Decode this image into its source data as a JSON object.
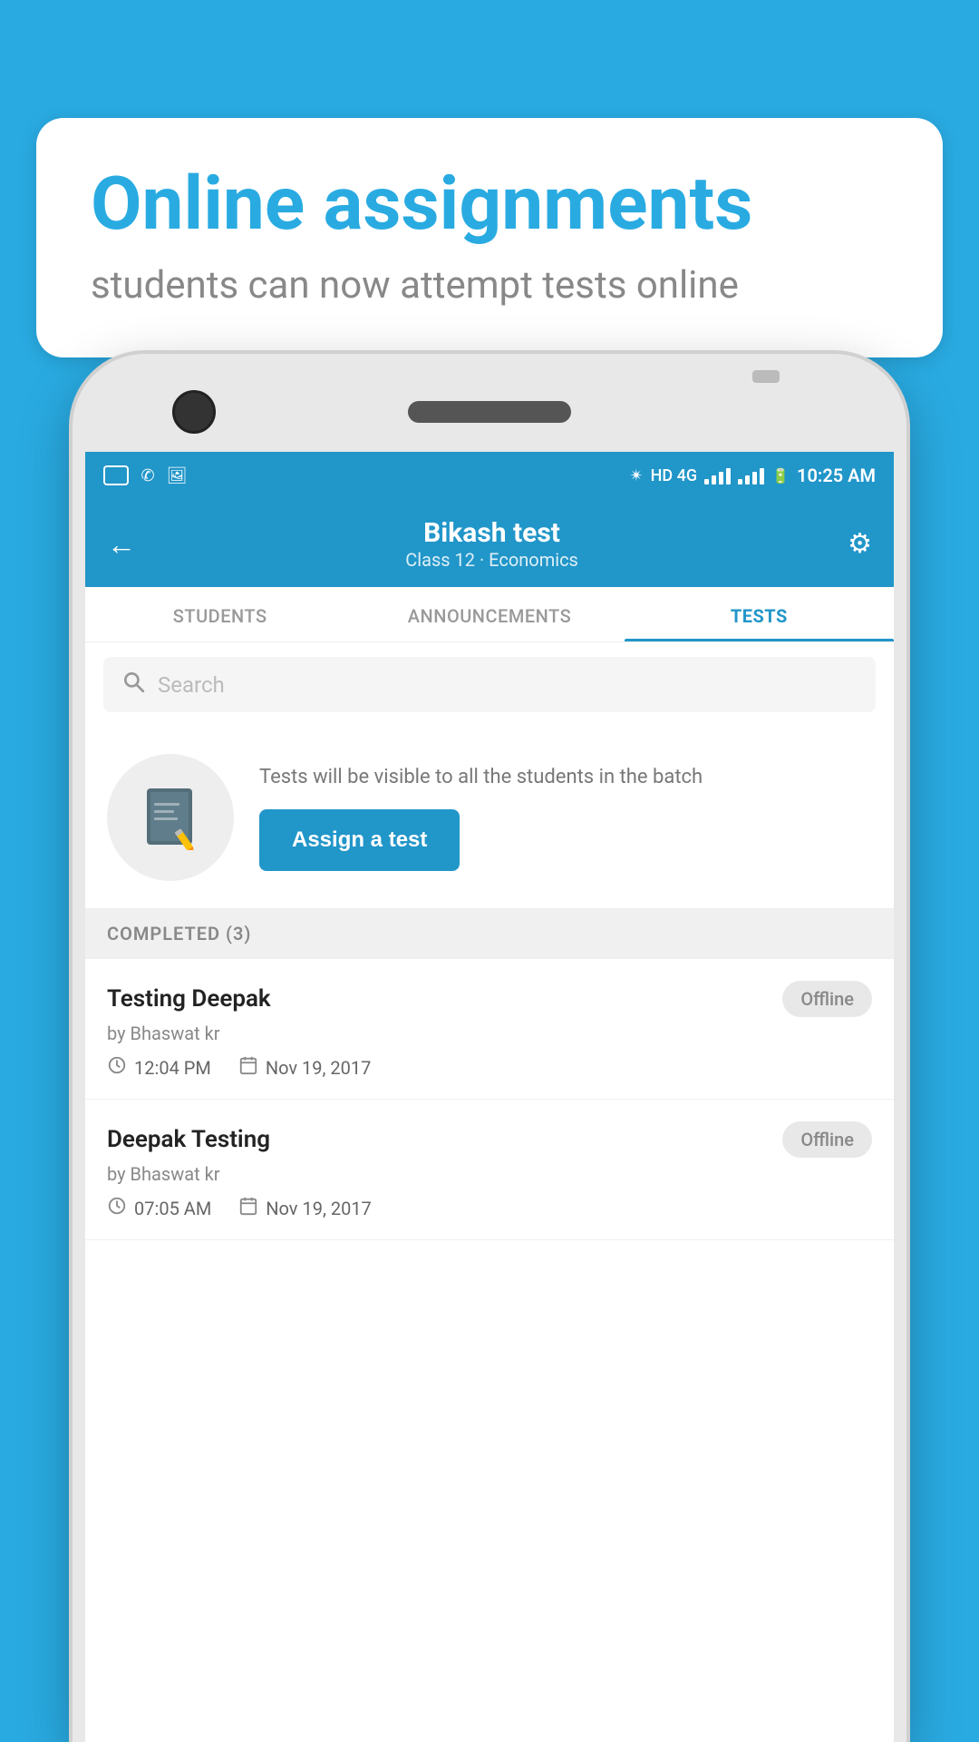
{
  "background_color": "#29ABE2",
  "bubble": {
    "title": "Online assignments",
    "subtitle": "students can now attempt tests online"
  },
  "status_bar": {
    "time": "10:25 AM",
    "network": "HD 4G"
  },
  "app_bar": {
    "title": "Bikash test",
    "subtitle": "Class 12 · Economics",
    "back_label": "←",
    "settings_label": "⚙"
  },
  "tabs": [
    {
      "label": "STUDENTS",
      "active": false
    },
    {
      "label": "ANNOUNCEMENTS",
      "active": false
    },
    {
      "label": "TESTS",
      "active": true
    }
  ],
  "search": {
    "placeholder": "Search"
  },
  "assign_section": {
    "description": "Tests will be visible to all the students in the batch",
    "button_label": "Assign a test"
  },
  "completed_header": "COMPLETED (3)",
  "tests": [
    {
      "name": "Testing Deepak",
      "author": "by Bhaswat kr",
      "time": "12:04 PM",
      "date": "Nov 19, 2017",
      "status": "Offline"
    },
    {
      "name": "Deepak Testing",
      "author": "by Bhaswat kr",
      "time": "07:05 AM",
      "date": "Nov 19, 2017",
      "status": "Offline"
    }
  ]
}
